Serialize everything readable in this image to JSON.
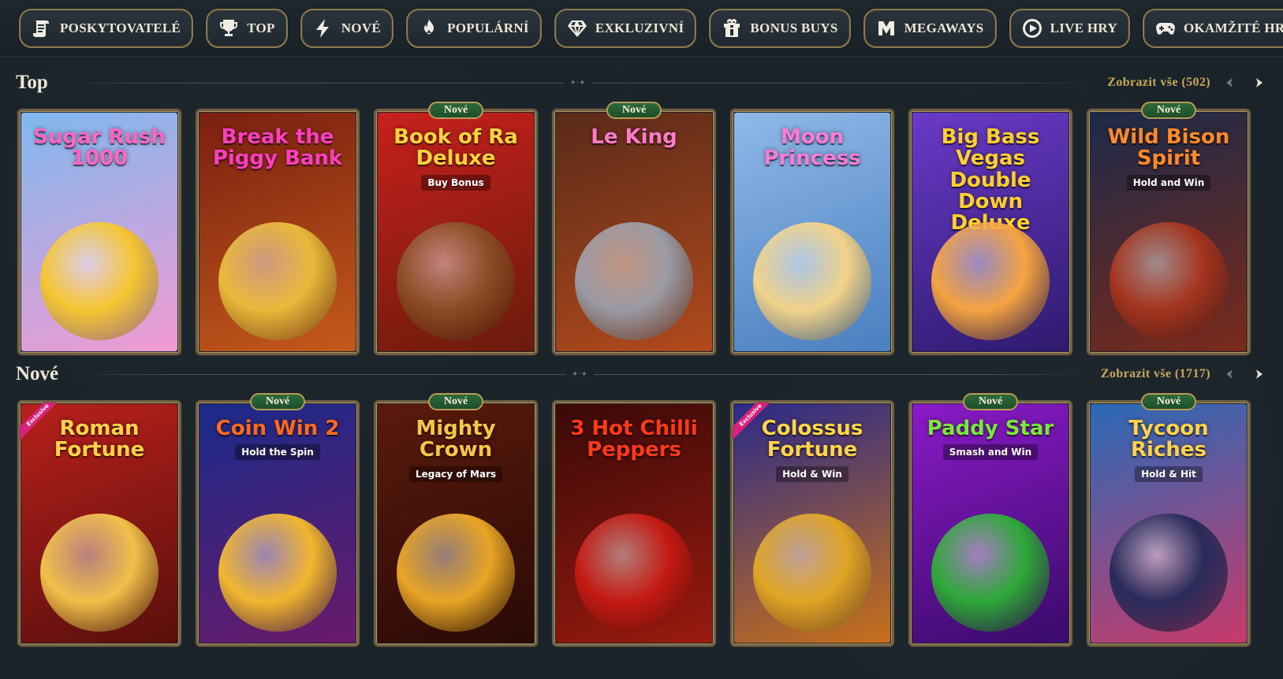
{
  "categories": [
    {
      "label": "Poskytovatelé",
      "icon": "scroll-icon"
    },
    {
      "label": "Top",
      "icon": "trophy-icon"
    },
    {
      "label": "Nové",
      "icon": "lightning-icon"
    },
    {
      "label": "Populární",
      "icon": "fire-icon"
    },
    {
      "label": "Exkluzivní",
      "icon": "diamond-icon"
    },
    {
      "label": "Bonus Buys",
      "icon": "gift-icon"
    },
    {
      "label": "Megaways",
      "icon": "megaways-icon"
    },
    {
      "label": "Live hry",
      "icon": "play-circle-icon"
    },
    {
      "label": "Okamžité hry",
      "icon": "gamepad-icon"
    }
  ],
  "sections": [
    {
      "title": "Top",
      "view_all": "Zobrazit vše (502)",
      "games": [
        {
          "title": "Sugar Rush 1000",
          "badge": "",
          "exclusive": false,
          "colors": [
            "#7fb8ef",
            "#f29ad2"
          ],
          "title_color": "#ff66c4",
          "figure": "#f5c531"
        },
        {
          "title": "Break the Piggy Bank",
          "badge": "",
          "exclusive": false,
          "colors": [
            "#7a1f10",
            "#c45a1b"
          ],
          "title_color": "#ff3fc0",
          "figure": "#e8b93a"
        },
        {
          "title": "Book of Ra Deluxe",
          "subtitle": "Buy Bonus",
          "badge": "Nové",
          "exclusive": false,
          "colors": [
            "#c8201c",
            "#6a1b0c"
          ],
          "title_color": "#ffd23f",
          "figure": "#8a4b22"
        },
        {
          "title": "Le King",
          "badge": "Nové",
          "exclusive": false,
          "colors": [
            "#5a2a1a",
            "#b24a1c"
          ],
          "title_color": "#ff7bc8",
          "figure": "#9a9aa4"
        },
        {
          "title": "Moon Princess",
          "badge": "",
          "exclusive": false,
          "colors": [
            "#8fb8e8",
            "#4a7fc0"
          ],
          "title_color": "#ff7ad6",
          "figure": "#f2d28a"
        },
        {
          "title": "Big Bass Vegas Double Down Deluxe",
          "badge": "",
          "exclusive": false,
          "colors": [
            "#6a3ac8",
            "#2e1a6e"
          ],
          "title_color": "#ffd02b",
          "figure": "#f4a340"
        },
        {
          "title": "Wild Bison Spirit",
          "subtitle": "Hold and Win",
          "badge": "Nové",
          "exclusive": false,
          "colors": [
            "#1c2a4a",
            "#7a2a1a"
          ],
          "title_color": "#ff8a2a",
          "figure": "#a4341e"
        }
      ]
    },
    {
      "title": "Nové",
      "view_all": "Zobrazit vše (1717)",
      "games": [
        {
          "title": "Roman Fortune",
          "badge": "",
          "exclusive": true,
          "exclusive_label": "Exclusive",
          "colors": [
            "#b8201c",
            "#5a0f0c"
          ],
          "title_color": "#ffd24a",
          "figure": "#f0c04a"
        },
        {
          "title": "Coin Win 2",
          "subtitle": "Hold the Spin",
          "badge": "Nové",
          "exclusive": false,
          "colors": [
            "#1a2a8a",
            "#6a1a6a"
          ],
          "title_color": "#ff6a1a",
          "figure": "#f1b52e"
        },
        {
          "title": "Mighty Crown",
          "subtitle": "Legacy of Mars",
          "badge": "Nové",
          "exclusive": false,
          "colors": [
            "#5a1a0c",
            "#2a0a06"
          ],
          "title_color": "#f4c64a",
          "figure": "#e8a424"
        },
        {
          "title": "3 Hot Chilli Peppers",
          "badge": "",
          "exclusive": false,
          "colors": [
            "#3a0a08",
            "#9a1a10"
          ],
          "title_color": "#ff3a1a",
          "figure": "#c41a12"
        },
        {
          "title": "Colossus Fortune",
          "subtitle": "Hold & Win",
          "badge": "",
          "exclusive": true,
          "exclusive_label": "Exclusive",
          "colors": [
            "#2a2a8a",
            "#c8701a"
          ],
          "title_color": "#ffd54a",
          "figure": "#e0a424"
        },
        {
          "title": "Paddy Star",
          "subtitle": "Smash and Win",
          "badge": "Nové",
          "exclusive": false,
          "colors": [
            "#8a1ac8",
            "#3a0a6a"
          ],
          "title_color": "#7ae83a",
          "figure": "#2ea838"
        },
        {
          "title": "Tycoon Riches",
          "subtitle": "Hold & Hit",
          "badge": "Nové",
          "exclusive": false,
          "colors": [
            "#2a6ab8",
            "#c83a6a"
          ],
          "title_color": "#ffd24a",
          "figure": "#2a2a5a"
        }
      ]
    }
  ]
}
